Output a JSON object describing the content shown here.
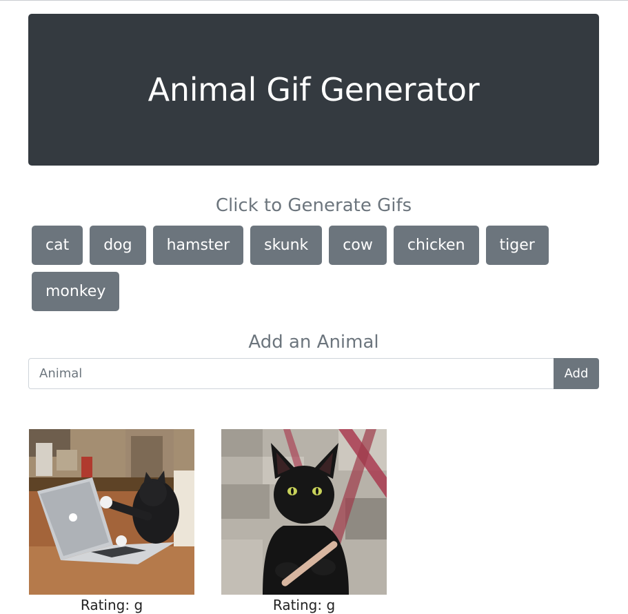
{
  "header": {
    "title": "Animal Gif Generator"
  },
  "click_section": {
    "heading": "Click to Generate Gifs",
    "buttons": [
      "cat",
      "dog",
      "hamster",
      "skunk",
      "cow",
      "chicken",
      "tiger",
      "monkey"
    ]
  },
  "add_section": {
    "heading": "Add an Animal",
    "input_placeholder": "Animal",
    "input_value": "",
    "add_label": "Add"
  },
  "gifs": [
    {
      "subject": "cat-on-laptop",
      "rating": "Rating: g"
    },
    {
      "subject": "black-cat-nail-file",
      "rating": "Rating: g"
    }
  ],
  "colors": {
    "jumbotron_bg": "#343a40",
    "button_bg": "#6c757d",
    "heading_text": "#6c757d"
  }
}
